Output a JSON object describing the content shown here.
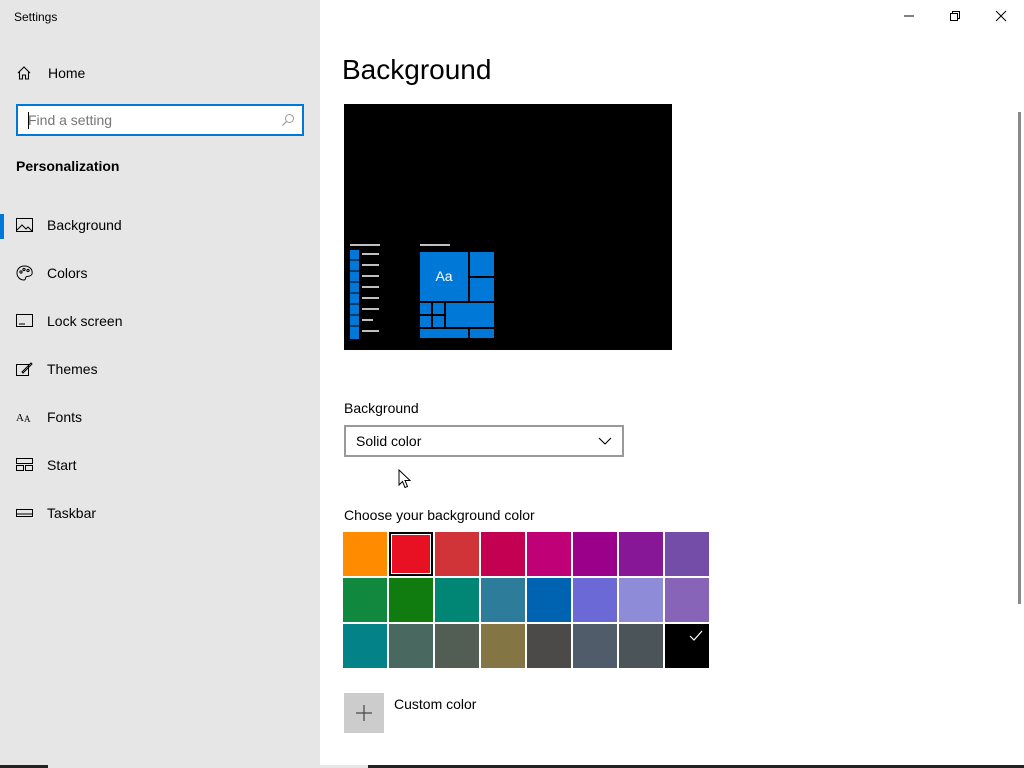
{
  "window": {
    "title": "Settings"
  },
  "sidebar": {
    "home_label": "Home",
    "search_placeholder": "Find a setting",
    "section_title": "Personalization",
    "items": [
      {
        "label": "Background",
        "icon": "picture-icon",
        "selected": true
      },
      {
        "label": "Colors",
        "icon": "palette-icon",
        "selected": false
      },
      {
        "label": "Lock screen",
        "icon": "lock-screen-icon",
        "selected": false
      },
      {
        "label": "Themes",
        "icon": "themes-icon",
        "selected": false
      },
      {
        "label": "Fonts",
        "icon": "fonts-icon",
        "selected": false
      },
      {
        "label": "Start",
        "icon": "start-icon",
        "selected": false
      },
      {
        "label": "Taskbar",
        "icon": "taskbar-icon",
        "selected": false
      }
    ]
  },
  "main": {
    "page_title": "Background",
    "preview": {
      "tile_text": "Aa",
      "accent": "#0078d7",
      "background": "#000000"
    },
    "background_label": "Background",
    "background_value": "Solid color",
    "color_label": "Choose your background color",
    "colors": [
      "#ff8c00",
      "#e81123",
      "#d13438",
      "#c30052",
      "#bf0077",
      "#9a0089",
      "#881798",
      "#744da9",
      "#10893e",
      "#107c10",
      "#018574",
      "#2d7d9a",
      "#0063b1",
      "#6b69d6",
      "#8e8cd8",
      "#8764b8",
      "#038387",
      "#486860",
      "#525e54",
      "#847545",
      "#4c4a48",
      "#515c6b",
      "#4a5459",
      "#000000"
    ],
    "outlined_color_index": 1,
    "checked_color_index": 23,
    "custom_color_label": "Custom color"
  }
}
